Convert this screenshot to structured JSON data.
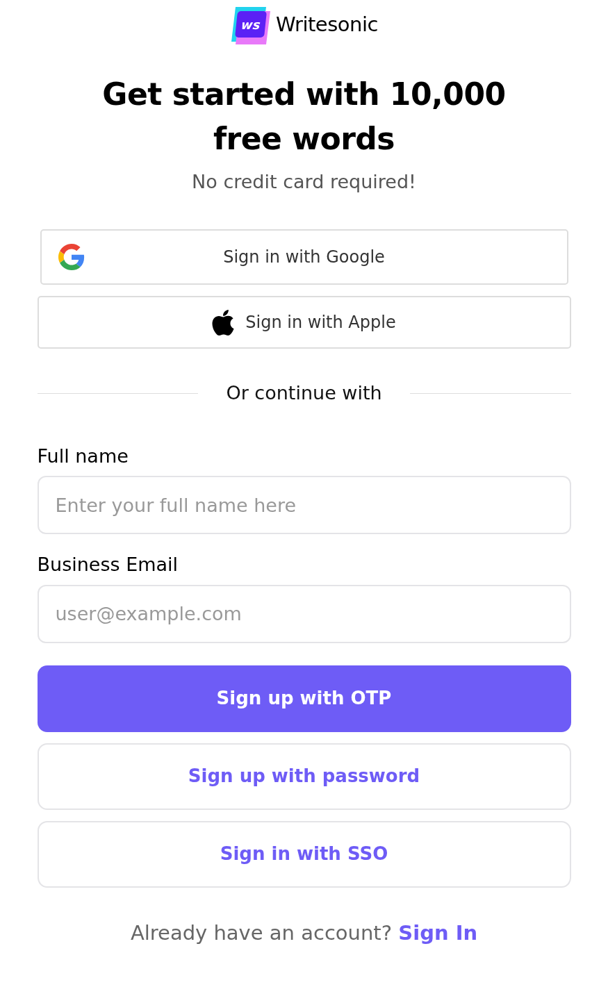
{
  "logo": {
    "mark": "ws",
    "name": "Writesonic"
  },
  "heading": "Get started with 10,000 free words",
  "subheading": "No credit card required!",
  "social_buttons": [
    {
      "kind": "google",
      "label": "Sign in with Google"
    },
    {
      "kind": "apple",
      "label": "Sign in with Apple"
    }
  ],
  "divider": "Or continue with",
  "fields": [
    {
      "label": "Full name",
      "placeholder": "Enter your full name here"
    },
    {
      "label": "Business Email",
      "placeholder": "user@example.com"
    }
  ],
  "actions": [
    {
      "kind": "primary",
      "label": "Sign up with OTP"
    },
    {
      "kind": "outline",
      "label": "Sign up with password"
    },
    {
      "kind": "outline",
      "label": "Sign in with SSO"
    }
  ],
  "footer": {
    "text": "Already have an account?",
    "link": "Sign In"
  }
}
